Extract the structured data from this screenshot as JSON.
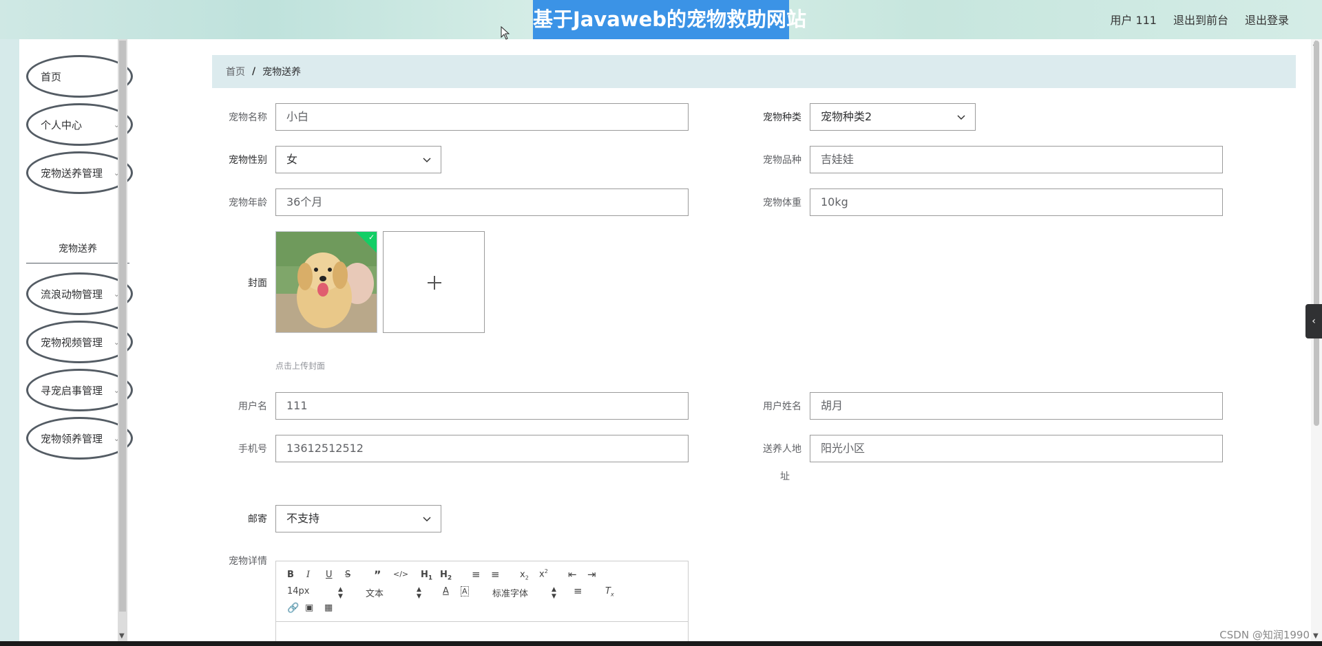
{
  "header": {
    "title": "基于Javaweb的宠物救助网站",
    "user": "用户 111",
    "front_link": "退出到前台",
    "logout_link": "退出登录",
    "bg_color": "#cfe8e4",
    "title_bg": "#3b93e6"
  },
  "sidebar": {
    "items": [
      {
        "label": "首页",
        "icon": "home"
      },
      {
        "label": "个人中心",
        "icon": "chevron-down-icon"
      },
      {
        "label": "宠物送养管理",
        "icon": "chevron-down-icon"
      },
      {
        "label": "流浪动物管理",
        "icon": "chevron-down-icon"
      },
      {
        "label": "宠物视频管理",
        "icon": "chevron-down-icon"
      },
      {
        "label": "寻宠启事管理",
        "icon": "chevron-down-icon"
      },
      {
        "label": "宠物领养管理",
        "icon": "chevron-down-icon"
      }
    ],
    "sub_item": "宠物送养"
  },
  "breadcrumb": {
    "home": "首页",
    "separator": "/",
    "current": "宠物送养"
  },
  "form": {
    "pet_name": {
      "label": "宠物名称",
      "value": "小白"
    },
    "pet_type": {
      "label": "宠物种类",
      "value": "宠物种类2"
    },
    "pet_gender": {
      "label": "宠物性别",
      "value": "女"
    },
    "pet_breed": {
      "label": "宠物品种",
      "value": "吉娃娃"
    },
    "pet_age": {
      "label": "宠物年龄",
      "value": "36个月"
    },
    "pet_weight": {
      "label": "宠物体重",
      "value": "10kg"
    },
    "cover": {
      "label": "封面",
      "hint": "点击上传封面"
    },
    "username": {
      "label": "用户名",
      "value": "111"
    },
    "user_realname": {
      "label": "用户姓名",
      "value": "胡月"
    },
    "phone": {
      "label": "手机号",
      "value": "13612512512"
    },
    "address": {
      "label_line1": "送养人地",
      "label_line2": "址",
      "value": "阳光小区"
    },
    "shipping": {
      "label": "邮寄",
      "value": "不支持"
    },
    "details": {
      "label": "宠物详情"
    }
  },
  "editor": {
    "font_size": "14px",
    "paragraph": "文本",
    "font_family": "标准字体"
  },
  "watermark": "CSDN @知润1990"
}
